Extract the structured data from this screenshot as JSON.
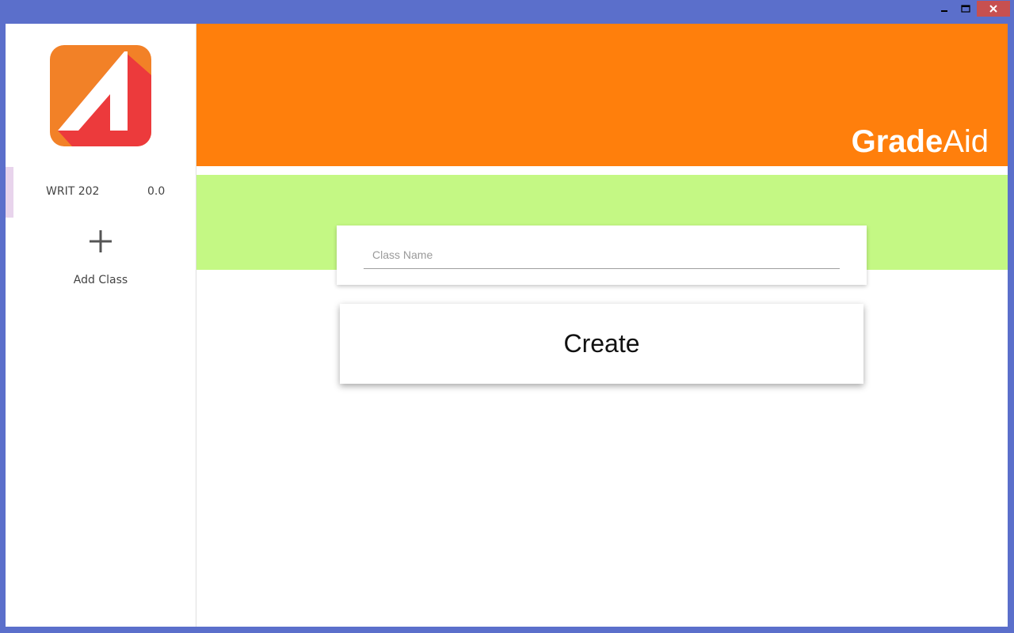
{
  "window": {
    "controls": {
      "minimize_icon": "minimize-icon",
      "maximize_icon": "maximize-icon",
      "close_icon": "close-icon"
    }
  },
  "sidebar": {
    "logo_icon": "gradeaid-logo",
    "classes": [
      {
        "name": "WRIT 202",
        "grade": "0.0"
      }
    ],
    "add_class_icon": "plus-icon",
    "add_class_label": "Add Class"
  },
  "header": {
    "brand_bold": "Grade",
    "brand_light": "Aid"
  },
  "form": {
    "class_name_placeholder": "Class Name",
    "class_name_value": "",
    "create_label": "Create"
  },
  "colors": {
    "window_frame": "#5b6fcb",
    "header_orange": "#ff7f0c",
    "band_green": "#c4f884",
    "close_red": "#c75050",
    "selected_marker": "#e8d4ec"
  }
}
